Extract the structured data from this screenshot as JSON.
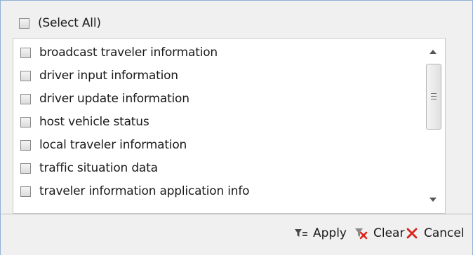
{
  "select_all": {
    "label": "(Select All)",
    "checked": false
  },
  "items": [
    {
      "label": "broadcast traveler information",
      "checked": false
    },
    {
      "label": "driver input information",
      "checked": false
    },
    {
      "label": "driver update information",
      "checked": false
    },
    {
      "label": "host vehicle status",
      "checked": false
    },
    {
      "label": "local traveler information",
      "checked": false
    },
    {
      "label": "traffic situation data",
      "checked": false
    },
    {
      "label": "traveler information application info",
      "checked": false
    }
  ],
  "buttons": {
    "apply": {
      "label": "Apply",
      "icon": "filter-apply-icon"
    },
    "clear": {
      "label": "Clear",
      "icon": "filter-clear-icon"
    },
    "cancel": {
      "label": "Cancel",
      "icon": "close-icon"
    }
  },
  "colors": {
    "frame_border": "#8fb0d6",
    "cancel_x": "#d9241c",
    "clear_x": "#d9241c",
    "filter_icon": "#4a4a4a"
  }
}
